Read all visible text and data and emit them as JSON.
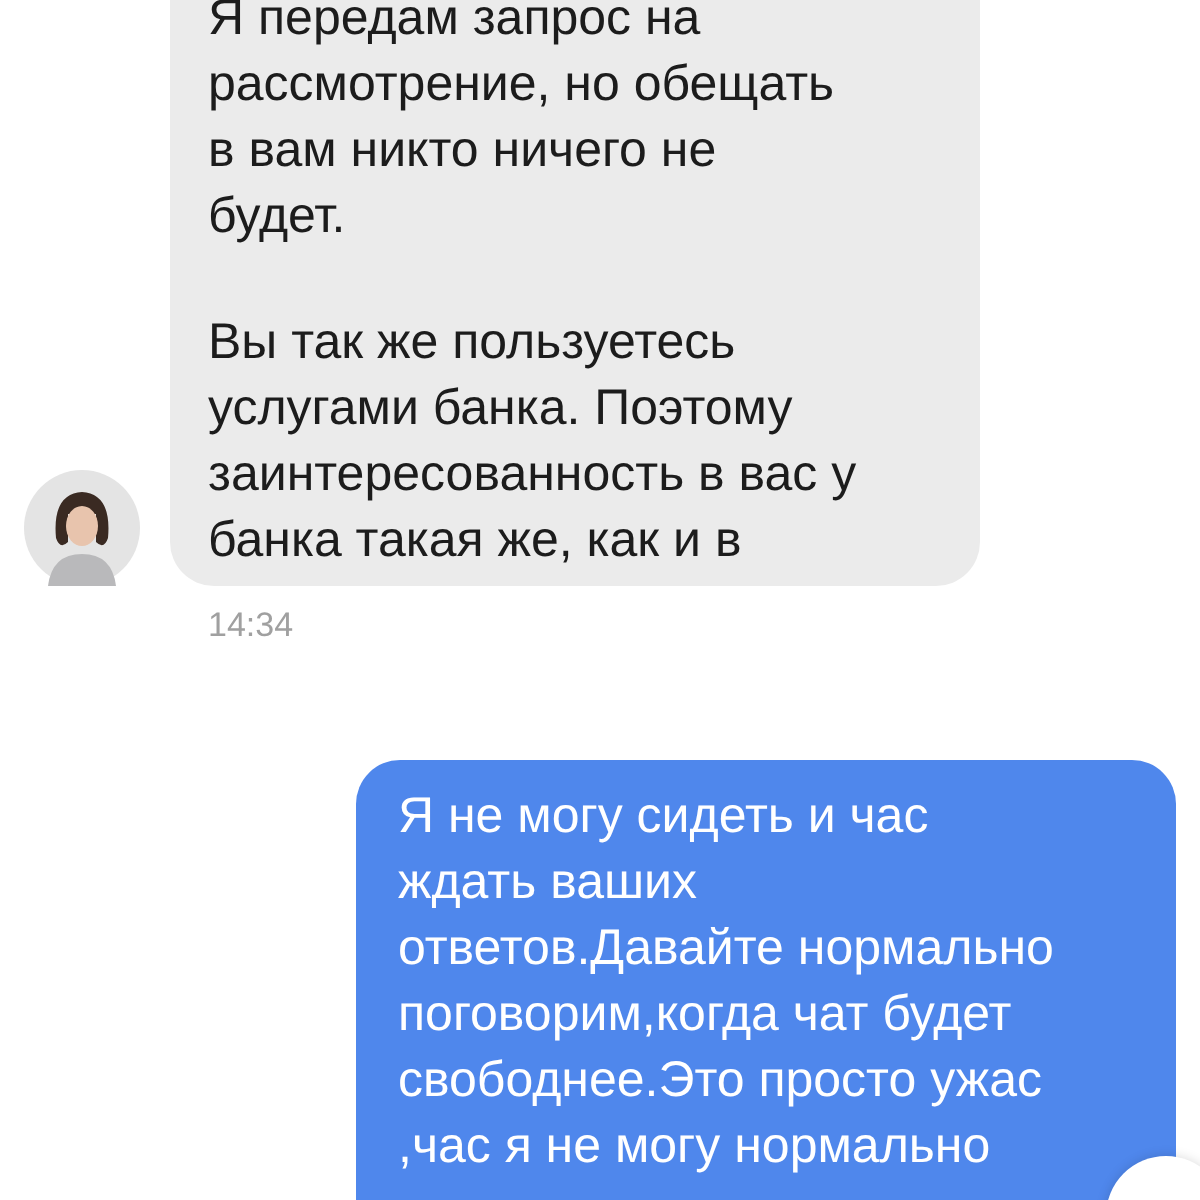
{
  "messages": [
    {
      "kind": "incoming",
      "paragraphs": [
        [
          "Я передам запрос на",
          "рассмотрение, но обещать",
          "в вам никто ничего не",
          "будет."
        ],
        [
          "Вы так же пользуетесь",
          "услугами банка. Поэтому",
          "заинтересованность в вас у",
          "банка такая же, как и в"
        ]
      ],
      "time": "14:34"
    },
    {
      "kind": "outgoing",
      "paragraphs": [
        [
          "Я не могу сидеть и час",
          "ждать ваших",
          "ответов.Давайте нормально",
          "поговорим,когда чат будет",
          "свободнее.Это просто ужас",
          ",час я не могу нормально"
        ]
      ]
    }
  ]
}
